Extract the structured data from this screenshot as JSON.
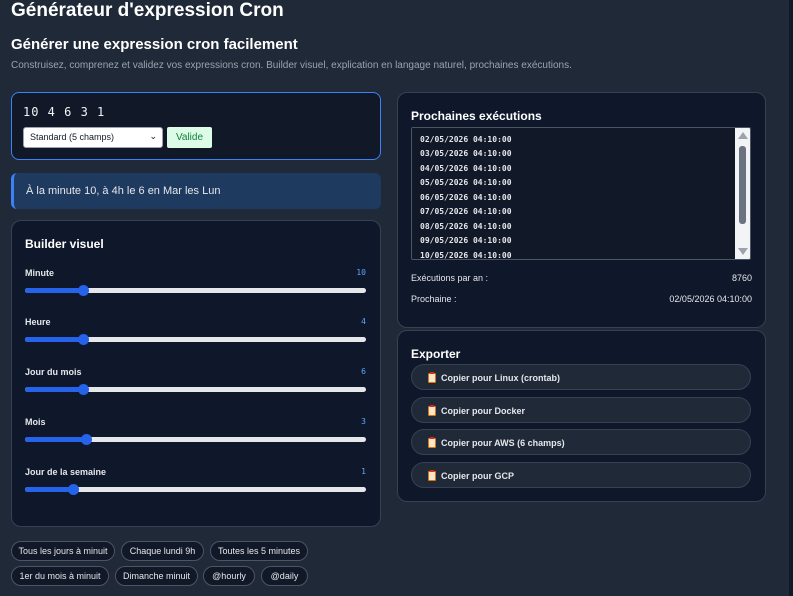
{
  "header": {
    "app_title": "Générateur d'expression Cron",
    "sub_title": "Générer une expression cron facilement",
    "description": "Construisez, comprenez et validez vos expressions cron. Builder visuel, explication en langage naturel, prochaines exécutions."
  },
  "expression": {
    "value": "10 4 6 3 1",
    "mode": "Standard (5 champs)",
    "status": "Valide",
    "status_color": "#15803d"
  },
  "explanation": "À la minute 10, à 4h le 6 en Mar les Lun",
  "builder": {
    "title": "Builder visuel",
    "fields": [
      {
        "label": "Minute",
        "value": "10",
        "level": 0.17
      },
      {
        "label": "Heure",
        "value": "4",
        "level": 0.17
      },
      {
        "label": "Jour du mois",
        "value": "6",
        "level": 0.17
      },
      {
        "label": "Mois",
        "value": "3",
        "level": 0.18
      },
      {
        "label": "Jour de la semaine",
        "value": "1",
        "level": 0.14
      }
    ]
  },
  "presets": [
    "Tous les jours à minuit",
    "Chaque lundi 9h",
    "Toutes les 5 minutes",
    "1er du mois à minuit",
    "Dimanche minuit",
    "@hourly",
    "@daily"
  ],
  "next_runs": {
    "title": "Prochaines exécutions",
    "items": [
      "02/05/2026 04:10:00",
      "03/05/2026 04:10:00",
      "04/05/2026 04:10:00",
      "05/05/2026 04:10:00",
      "06/05/2026 04:10:00",
      "07/05/2026 04:10:00",
      "08/05/2026 04:10:00",
      "09/05/2026 04:10:00",
      "10/05/2026 04:10:00"
    ],
    "per_year_label": "Exécutions par an :",
    "per_year_value": "8760",
    "next_label": "Prochaine :",
    "next_value": "02/05/2026 04:10:00"
  },
  "export": {
    "title": "Exporter",
    "buttons": [
      "Copier pour Linux (crontab)",
      "Copier pour Docker",
      "Copier pour AWS (6 champs)",
      "Copier pour GCP"
    ]
  },
  "colors": {
    "accent": "#2563eb",
    "background": "#1f2937",
    "panel": "#0f172a"
  }
}
